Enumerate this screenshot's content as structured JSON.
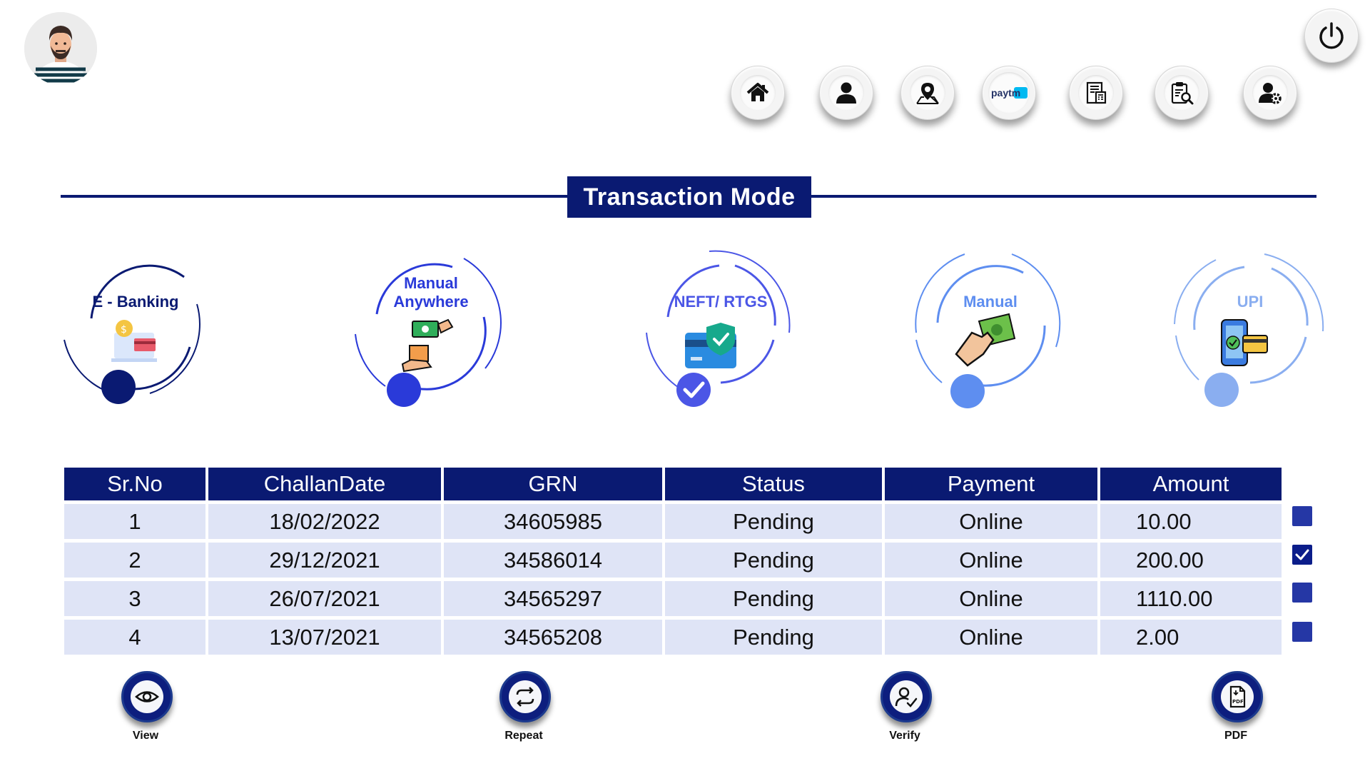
{
  "title": "Transaction Mode",
  "header": {
    "nav_icons": [
      "home-icon",
      "user-icon",
      "map-pin-icon",
      "paytm-icon",
      "receipt-icon",
      "clipboard-search-icon",
      "user-settings-icon"
    ],
    "paytm_text": "paytm"
  },
  "modes": [
    {
      "label": "E - Banking",
      "color": "#0a1a72"
    },
    {
      "label": "Manual Anywhere",
      "color": "#2a3ad9"
    },
    {
      "label": "NEFT/ RTGS",
      "color": "#4b56e6"
    },
    {
      "label": "Manual",
      "color": "#5e8ef0"
    },
    {
      "label": "UPI",
      "color": "#8aaef0"
    }
  ],
  "table": {
    "columns": [
      "Sr.No",
      "ChallanDate",
      "GRN",
      "Status",
      "Payment",
      "Amount"
    ],
    "rows": [
      {
        "srno": "1",
        "date": "18/02/2022",
        "grn": "34605985",
        "status": "Pending",
        "payment": "Online",
        "amount": "10.00",
        "checked": false
      },
      {
        "srno": "2",
        "date": "29/12/2021",
        "grn": "34586014",
        "status": "Pending",
        "payment": "Online",
        "amount": "200.00",
        "checked": true
      },
      {
        "srno": "3",
        "date": "26/07/2021",
        "grn": "34565297",
        "status": "Pending",
        "payment": "Online",
        "amount": "1110.00",
        "checked": false
      },
      {
        "srno": "4",
        "date": "13/07/2021",
        "grn": "34565208",
        "status": "Pending",
        "payment": "Online",
        "amount": "2.00",
        "checked": false
      }
    ]
  },
  "actions": {
    "view": "View",
    "repeat": "Repeat",
    "verify": "Verify",
    "pdf": "PDF",
    "pdf_icon_text": "PDF"
  }
}
